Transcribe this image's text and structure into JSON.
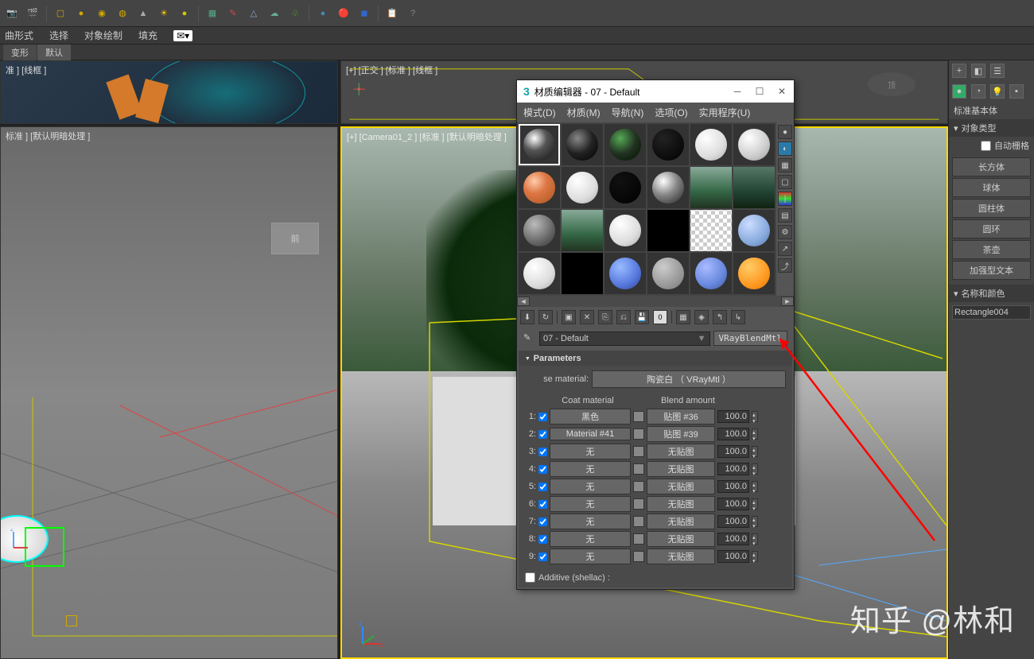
{
  "menubar": {
    "items": [
      "曲形式",
      "选择",
      "对象绘制",
      "填充"
    ]
  },
  "subtabs": {
    "tab1": "变形",
    "tab2": "默认"
  },
  "viewports": {
    "vp1_label": "准 ] [线框 ]",
    "vp2_label": "[+] [正交 ] [标准 ] [线框 ]",
    "vp3_label": "标准 ] [默认明暗处理 ]",
    "vp3_front": "前",
    "vp4_label": "[+] [Camera01_2 ] [标准 ] [默认明暗处理 ]"
  },
  "right_panel": {
    "header1": "标准基本体",
    "section_object_type": "对象类型",
    "auto_label": "自动栅格",
    "buttons": [
      "长方体",
      "球体",
      "圆柱体",
      "圆环",
      "茶壶",
      "加强型文本"
    ],
    "section_name_color": "名称和颜色",
    "object_name": "Rectangle004"
  },
  "mat_editor": {
    "title": "材质编辑器 - 07 - Default",
    "menu": {
      "mode": "模式(D)",
      "material": "材质(M)",
      "nav": "导航(N)",
      "option": "选项(O)",
      "util": "实用程序(U)"
    },
    "material_name": "07 - Default",
    "material_type": "VRayBlendMtl",
    "params_header": "Parameters",
    "base_label": "se material:",
    "base_material": "陶瓷白  （ VRayMtl ）",
    "col_coat": "Coat material",
    "col_blend": "Blend amount",
    "coats": [
      {
        "idx": "1:",
        "mat": "黑色",
        "map": "贴图 #36",
        "amt": "100.0"
      },
      {
        "idx": "2:",
        "mat": "Material #41",
        "map": "贴图 #39",
        "amt": "100.0"
      },
      {
        "idx": "3:",
        "mat": "无",
        "map": "无贴图",
        "amt": "100.0"
      },
      {
        "idx": "4:",
        "mat": "无",
        "map": "无贴图",
        "amt": "100.0"
      },
      {
        "idx": "5:",
        "mat": "无",
        "map": "无贴图",
        "amt": "100.0"
      },
      {
        "idx": "6:",
        "mat": "无",
        "map": "无贴图",
        "amt": "100.0"
      },
      {
        "idx": "7:",
        "mat": "无",
        "map": "无贴图",
        "amt": "100.0"
      },
      {
        "idx": "8:",
        "mat": "无",
        "map": "无贴图",
        "amt": "100.0"
      },
      {
        "idx": "9:",
        "mat": "无",
        "map": "无贴图",
        "amt": "100.0"
      }
    ],
    "additive_label": "Additive (shellac) :"
  },
  "watermark": "知乎 @林和",
  "toolbar_icons": [
    "camera",
    "film",
    "box",
    "sphere",
    "geosphere",
    "torus",
    "cone",
    "sun",
    "yellow-sphere",
    "particles",
    "paint",
    "axis",
    "cloud",
    "grass",
    "globe",
    "colors",
    "blue-box",
    "clipboard",
    "help"
  ]
}
